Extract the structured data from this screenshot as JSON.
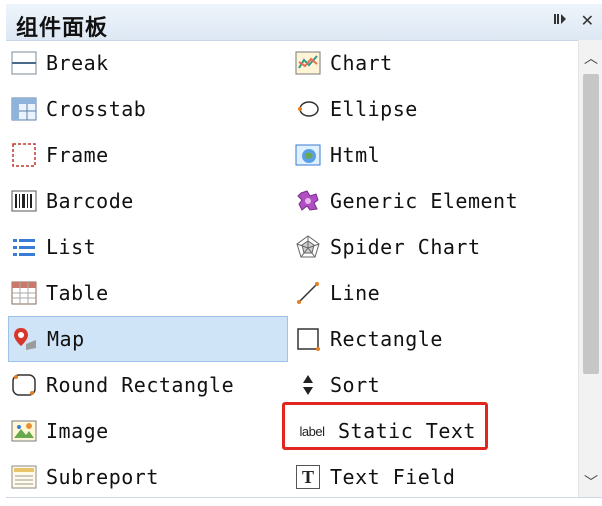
{
  "panel": {
    "title": "组件面板",
    "pin_icon": "pin-icon",
    "close_icon": "close-icon"
  },
  "items_left": [
    {
      "label": "Break",
      "icon": "break-icon"
    },
    {
      "label": "Crosstab",
      "icon": "crosstab-icon"
    },
    {
      "label": "Frame",
      "icon": "frame-icon"
    },
    {
      "label": "Barcode",
      "icon": "barcode-icon"
    },
    {
      "label": "List",
      "icon": "list-icon"
    },
    {
      "label": "Table",
      "icon": "table-icon"
    },
    {
      "label": "Map",
      "icon": "map-pin-icon",
      "selected": true
    },
    {
      "label": "Round Rectangle",
      "icon": "round-rectangle-icon"
    },
    {
      "label": "Image",
      "icon": "image-icon"
    },
    {
      "label": "Subreport",
      "icon": "subreport-icon"
    }
  ],
  "items_right": [
    {
      "label": "Chart",
      "icon": "chart-icon"
    },
    {
      "label": "Ellipse",
      "icon": "ellipse-icon"
    },
    {
      "label": "Html",
      "icon": "html-icon"
    },
    {
      "label": "Generic Element",
      "icon": "generic-element-icon"
    },
    {
      "label": "Spider Chart",
      "icon": "spider-chart-icon"
    },
    {
      "label": "Line",
      "icon": "line-icon"
    },
    {
      "label": "Rectangle",
      "icon": "rectangle-icon"
    },
    {
      "label": "Sort",
      "icon": "sort-icon"
    },
    {
      "label": "Static Text",
      "icon": "static-text-icon",
      "icon_text": "label",
      "highlighted": true
    },
    {
      "label": "Text Field",
      "icon": "text-field-icon",
      "icon_text": "T"
    }
  ],
  "colors": {
    "selection": "#cfe4f7",
    "highlight_box": "#e0261f"
  }
}
